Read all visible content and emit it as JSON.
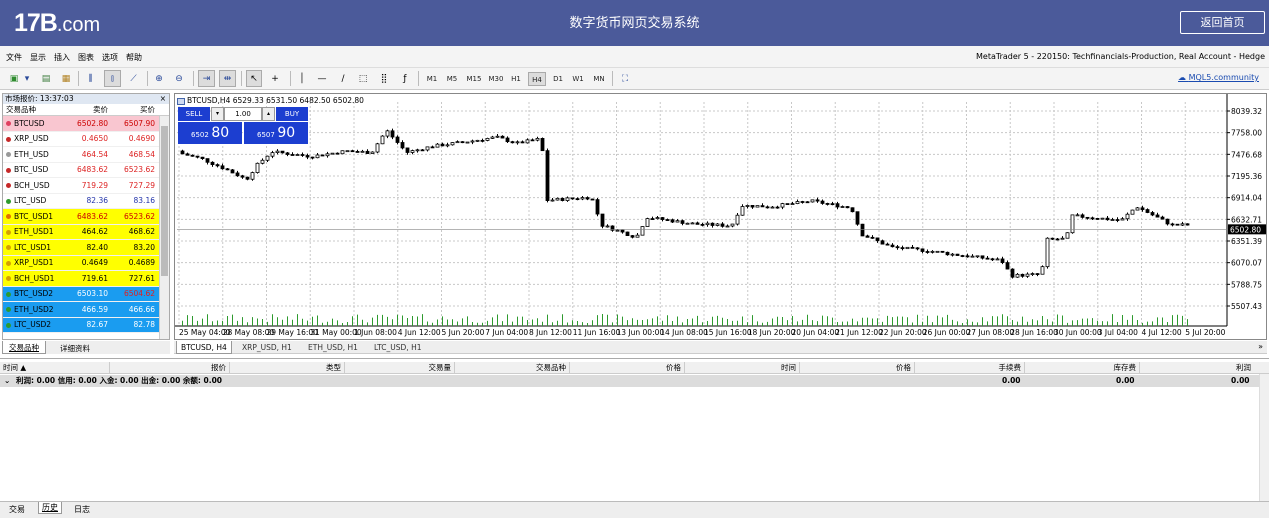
{
  "header": {
    "logo_main": "17B",
    "logo_domain": ".com",
    "title": "数字货币网页交易系统",
    "home_button": "返回首页"
  },
  "menu": [
    "文件",
    "显示",
    "插入",
    "图表",
    "选项",
    "帮助"
  ],
  "account_info": "MetaTrader 5 - 220150: Techfinancials-Production, Real Account - Hedge",
  "toolbar": {
    "timeframes": [
      "M1",
      "M5",
      "M15",
      "M30",
      "H1",
      "H4",
      "D1",
      "W1",
      "MN"
    ],
    "active_timeframe": "H4",
    "mql5_link": "MQL5.community"
  },
  "market_watch": {
    "title": "市场报价: 13:37:03",
    "close": "×",
    "columns": [
      "交易品种",
      "卖价",
      "买价"
    ],
    "rows": [
      {
        "symbol": "BTCUSD",
        "bid": "6502.80",
        "ask": "6507.90",
        "bg": "#f9c6d0",
        "dot": "#e04060",
        "bidc": "#c00",
        "askc": "#c00"
      },
      {
        "symbol": "XRP_USD",
        "bid": "0.4650",
        "ask": "0.4690",
        "bg": "#ffffff",
        "dot": "#c62828",
        "bidc": "#d22",
        "askc": "#d22"
      },
      {
        "symbol": "ETH_USD",
        "bid": "464.54",
        "ask": "468.54",
        "bg": "#ffffff",
        "dot": "#999999",
        "bidc": "#d22",
        "askc": "#d22"
      },
      {
        "symbol": "BTC_USD",
        "bid": "6483.62",
        "ask": "6523.62",
        "bg": "#ffffff",
        "dot": "#c62828",
        "bidc": "#d22",
        "askc": "#d22"
      },
      {
        "symbol": "BCH_USD",
        "bid": "719.29",
        "ask": "727.29",
        "bg": "#ffffff",
        "dot": "#c62828",
        "bidc": "#d22",
        "askc": "#d22"
      },
      {
        "symbol": "LTC_USD",
        "bid": "82.36",
        "ask": "83.16",
        "bg": "#ffffff",
        "dot": "#2e9a2e",
        "bidc": "#2233aa",
        "askc": "#2233aa"
      },
      {
        "symbol": "BTC_USD1",
        "bid": "6483.62",
        "ask": "6523.62",
        "bg": "#ffff00",
        "dot": "#e07000",
        "bidc": "#c00",
        "askc": "#c00"
      },
      {
        "symbol": "ETH_USD1",
        "bid": "464.62",
        "ask": "468.62",
        "bg": "#ffff00",
        "dot": "#d4a000",
        "bidc": "#000",
        "askc": "#000"
      },
      {
        "symbol": "LTC_USD1",
        "bid": "82.40",
        "ask": "83.20",
        "bg": "#ffff00",
        "dot": "#d4a000",
        "bidc": "#000",
        "askc": "#000"
      },
      {
        "symbol": "XRP_USD1",
        "bid": "0.4649",
        "ask": "0.4689",
        "bg": "#ffff00",
        "dot": "#d4a000",
        "bidc": "#000",
        "askc": "#000"
      },
      {
        "symbol": "BCH_USD1",
        "bid": "719.61",
        "ask": "727.61",
        "bg": "#ffff00",
        "dot": "#d4a000",
        "bidc": "#000",
        "askc": "#000"
      },
      {
        "symbol": "BTC_USD2",
        "bid": "6503.10",
        "ask": "6504.62",
        "bg": "#1a9cf0",
        "dot": "#2e9a2e",
        "bidc": "#fff",
        "askc": "#e02020"
      },
      {
        "symbol": "ETH_USD2",
        "bid": "466.59",
        "ask": "466.66",
        "bg": "#1a9cf0",
        "dot": "#2e9a2e",
        "bidc": "#fff",
        "askc": "#fff"
      },
      {
        "symbol": "LTC_USD2",
        "bid": "82.67",
        "ask": "82.78",
        "bg": "#1a9cf0",
        "dot": "#2e9a2e",
        "bidc": "#fff",
        "askc": "#fff"
      }
    ],
    "tabs": [
      "交易品种",
      "详细资料"
    ]
  },
  "chart": {
    "title": "BTCUSD,H4  6529.33 6531.50 6482.50 6502.80",
    "sell_label": "SELL",
    "buy_label": "BUY",
    "lot": "1.00",
    "sell_small": "6502",
    "sell_big": "80",
    "buy_small": "6507",
    "buy_big": "90",
    "tabs": [
      "BTCUSD, H4",
      "XRP_USD, H1",
      "ETH_USD, H1",
      "LTC_USD, H1"
    ],
    "overflow_icon": "»"
  },
  "chart_data": {
    "type": "candlestick",
    "symbol": "BTCUSD",
    "timeframe": "H4",
    "ylim": [
      5507.43,
      8039.32
    ],
    "y_ticks": [
      "8039.32",
      "7758.00",
      "7476.68",
      "7195.36",
      "6914.04",
      "6632.71",
      "6351.39",
      "6070.07",
      "5788.75",
      "5507.43"
    ],
    "current_price": "6502.80",
    "x_ticks": [
      "25 May 04:00",
      "28 May 08:00",
      "29 May 16:00",
      "31 May 00:00",
      "1 Jun 08:00",
      "4 Jun 12:00",
      "5 Jun 20:00",
      "7 Jun 04:00",
      "8 Jun 12:00",
      "11 Jun 16:00",
      "13 Jun 00:00",
      "14 Jun 08:00",
      "15 Jun 16:00",
      "18 Jun 20:00",
      "20 Jun 04:00",
      "21 Jun 12:00",
      "22 Jun 20:00",
      "26 Jun 00:00",
      "27 Jun 08:00",
      "28 Jun 16:00",
      "30 Jun 00:00",
      "3 Jul 04:00",
      "4 Jul 12:00",
      "5 Jul 20:00"
    ],
    "grid": true,
    "volume": true
  },
  "toolbox": {
    "columns": [
      "时间 ▲",
      "报价",
      "类型",
      "交易量",
      "交易品种",
      "价格",
      "时间",
      "价格",
      "手续费",
      "库存费",
      "利润"
    ],
    "summary": "利润: 0.00  信用: 0.00  入金: 0.00  出金: 0.00  余额: 0.00",
    "commission": "0.00",
    "swap": "0.00",
    "profit": "0.00"
  },
  "bottom_tabs": [
    "交易",
    "历史",
    "日志"
  ]
}
